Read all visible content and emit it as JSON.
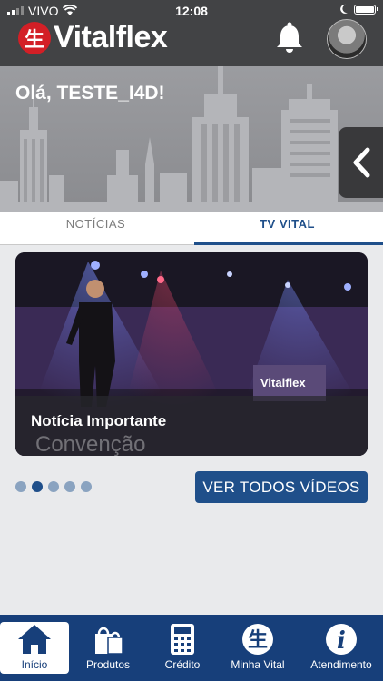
{
  "status_bar": {
    "carrier": "VIVO",
    "time": "12:08"
  },
  "header": {
    "brand": "Vitalflex",
    "logo_glyph": "生",
    "bell_icon": "bell-icon",
    "avatar": "user-avatar"
  },
  "hero": {
    "greeting": "Olá, TESTE_I4D!"
  },
  "tabs": [
    {
      "label": "NOTÍCIAS",
      "active": false
    },
    {
      "label": "TV VITAL",
      "active": true
    }
  ],
  "video": {
    "caption": "Notícia Importante",
    "overlay_text": "Convenção",
    "screen_logo": "Vitalflex"
  },
  "carousel": {
    "count": 5,
    "active_index": 1
  },
  "actions": {
    "see_all": "VER TODOS VÍDEOS"
  },
  "nav": [
    {
      "label": "Início",
      "icon": "home-icon",
      "active": true
    },
    {
      "label": "Produtos",
      "icon": "shopping-bag-icon",
      "active": false
    },
    {
      "label": "Crédito",
      "icon": "calculator-icon",
      "active": false
    },
    {
      "label": "Minha Vital",
      "icon": "vital-logo-icon",
      "active": false
    },
    {
      "label": "Atendimento",
      "icon": "info-icon",
      "active": false
    }
  ],
  "colors": {
    "primary": "#1f4f8a",
    "nav": "#173f7a",
    "header": "#424345",
    "brand_red": "#d31f26"
  }
}
